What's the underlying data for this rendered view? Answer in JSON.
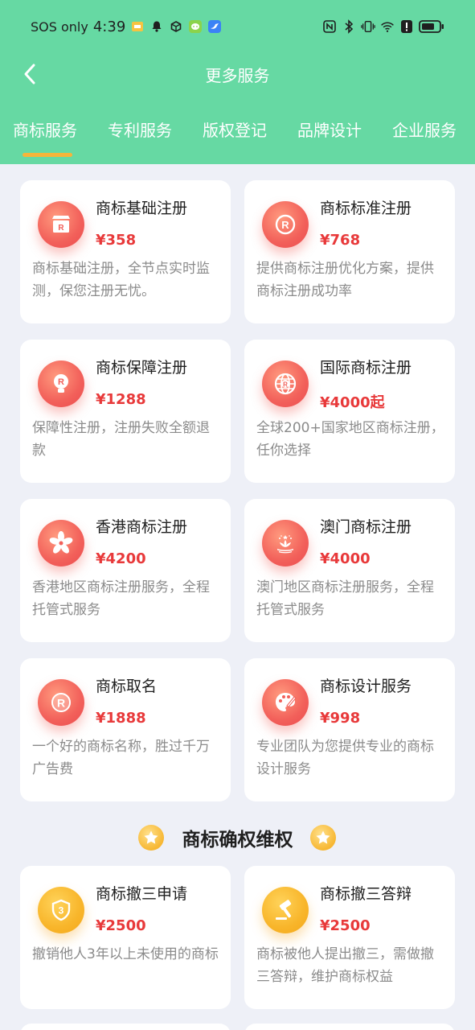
{
  "status": {
    "carrier": "SOS only",
    "time": "4:39"
  },
  "nav": {
    "title": "更多服务"
  },
  "tabs": [
    {
      "label": "商标服务",
      "active": true
    },
    {
      "label": "专利服务",
      "active": false
    },
    {
      "label": "版权登记",
      "active": false
    },
    {
      "label": "品牌设计",
      "active": false
    },
    {
      "label": "企业服务",
      "active": false
    }
  ],
  "colors": {
    "header": "#66d9a3",
    "price": "#e8393a",
    "tab_indicator": "#f6b53a",
    "background": "#eef0f7"
  },
  "cards": [
    {
      "title": "商标基础注册",
      "price": "¥358",
      "desc": "商标基础注册，全节点实时监测，保您注册无忧。",
      "icon": "store-r-icon"
    },
    {
      "title": "商标标准注册",
      "price": "¥768",
      "desc": "提供商标注册优化方案，提供商标注册成功率",
      "icon": "registered-circle-icon"
    },
    {
      "title": "商标保障注册",
      "price": "¥1288",
      "desc": "保障性注册，注册失败全额退款",
      "icon": "bulb-r-icon"
    },
    {
      "title": "国际商标注册",
      "price": "¥4000起",
      "desc": "全球200+国家地区商标注册，任你选择",
      "icon": "globe-r-icon"
    },
    {
      "title": "香港商标注册",
      "price": "¥4200",
      "desc": "香港地区商标注册服务，全程托管式服务",
      "icon": "bauhinia-icon"
    },
    {
      "title": "澳门商标注册",
      "price": "¥4000",
      "desc": "澳门地区商标注册服务，全程托管式服务",
      "icon": "lotus-icon"
    },
    {
      "title": "商标取名",
      "price": "¥1888",
      "desc": "一个好的商标名称，胜过千万广告费",
      "icon": "registered-circle-icon"
    },
    {
      "title": "商标设计服务",
      "price": "¥998",
      "desc": "专业团队为您提供专业的商标设计服务",
      "icon": "palette-icon"
    }
  ],
  "section": {
    "title": "商标确权维权"
  },
  "section_cards": [
    {
      "title": "商标撤三申请",
      "price": "¥2500",
      "desc": "撤销他人3年以上未使用的商标",
      "icon": "shield-3-icon"
    },
    {
      "title": "商标撤三答辩",
      "price": "¥2500",
      "desc": "商标被他人提出撤三，需做撤三答辩，维护商标权益",
      "icon": "gavel-icon"
    }
  ]
}
